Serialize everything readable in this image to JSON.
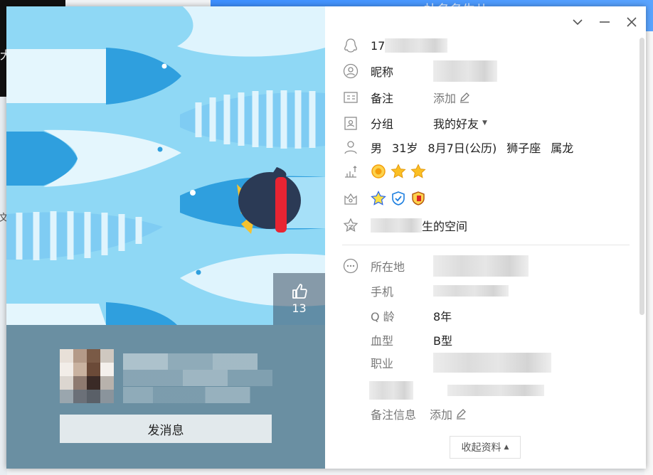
{
  "desktop": {
    "left_text": "大",
    "top_text": "杜名名生儿",
    "side_text": "文"
  },
  "cover": {
    "likes": "13"
  },
  "profile": {
    "send_message": "发消息"
  },
  "window_controls": [
    "chevron-down",
    "minimize",
    "close"
  ],
  "info": {
    "qq_prefix": "17",
    "nickname_label": "昵称",
    "remark_label": "备注",
    "remark_add": "添加",
    "group_label": "分组",
    "group_value": "我的好友",
    "gender": "男",
    "age": "31岁",
    "birthday": "8月7日(公历)",
    "zodiac": "狮子座",
    "chinese_zodiac": "属龙",
    "space_suffix": "生的空间"
  },
  "details": {
    "location_label": "所在地",
    "phone_label": "手机",
    "qage_label": "Q 龄",
    "qage_value": "8年",
    "blood_label": "血型",
    "blood_value": "B型",
    "job_label": "职业",
    "remark_info_label": "备注信息",
    "remark_info_add": "添加"
  },
  "collapse": {
    "label": "收起资料",
    "icon": "caret-up"
  },
  "colors": {
    "cover_sky": "#8fd8f5",
    "card": "#6a8fa2",
    "fish_blue": "#2f9fde"
  }
}
